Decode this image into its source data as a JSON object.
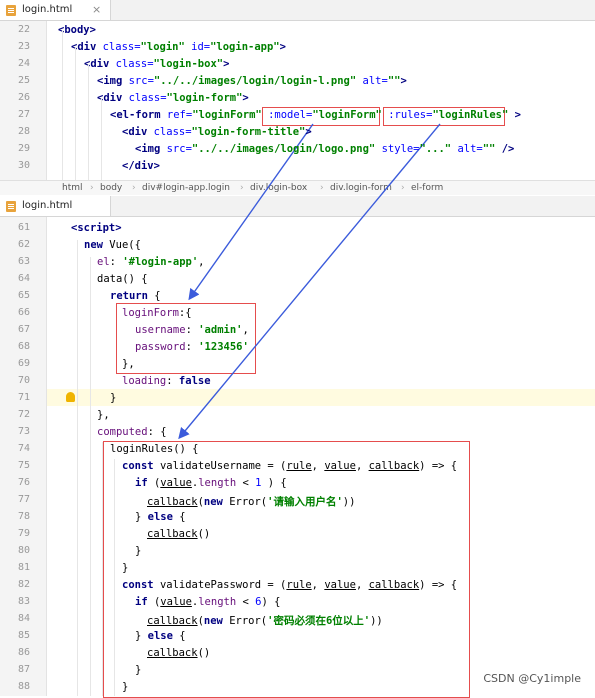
{
  "top_pane": {
    "tab": {
      "filename": "login.html",
      "close": "×"
    },
    "lines": [
      {
        "n": "22",
        "segs": [
          [
            "tag",
            "<body>"
          ]
        ]
      },
      {
        "n": "23",
        "segs": [
          [
            "tag",
            "<div "
          ],
          [
            "attr",
            "class="
          ],
          [
            "str",
            "\"login\" "
          ],
          [
            "attr",
            "id="
          ],
          [
            "str",
            "\"login-app\""
          ],
          [
            "tag",
            ">"
          ]
        ]
      },
      {
        "n": "24",
        "segs": [
          [
            "tag",
            "<div "
          ],
          [
            "attr",
            "class="
          ],
          [
            "str",
            "\"login-box\""
          ],
          [
            "tag",
            ">"
          ]
        ]
      },
      {
        "n": "25",
        "segs": [
          [
            "tag",
            "<img "
          ],
          [
            "attr",
            "src="
          ],
          [
            "str",
            "\"../../images/login/login-l.png\" "
          ],
          [
            "attr",
            "alt="
          ],
          [
            "str",
            "\"\""
          ],
          [
            "tag",
            ">"
          ]
        ]
      },
      {
        "n": "26",
        "segs": [
          [
            "tag",
            "<div "
          ],
          [
            "attr",
            "class="
          ],
          [
            "str",
            "\"login-form\""
          ],
          [
            "tag",
            ">"
          ]
        ]
      },
      {
        "n": "27",
        "segs": [
          [
            "tag",
            "<el-form "
          ],
          [
            "attr",
            "ref="
          ],
          [
            "str",
            "\"loginForm\" "
          ],
          [
            "attr",
            ":model="
          ],
          [
            "str",
            "\"loginForm\" "
          ],
          [
            "attr",
            ":rules="
          ],
          [
            "str",
            "\"loginRules\" "
          ],
          [
            "tag",
            ">"
          ]
        ]
      },
      {
        "n": "28",
        "segs": [
          [
            "tag",
            "<div "
          ],
          [
            "attr",
            "class="
          ],
          [
            "str",
            "\"login-form-title\""
          ],
          [
            "tag",
            ">"
          ]
        ]
      },
      {
        "n": "29",
        "segs": [
          [
            "tag",
            "<img "
          ],
          [
            "attr",
            "src="
          ],
          [
            "str",
            "\"../../images/login/logo.png\" "
          ],
          [
            "attr",
            "style="
          ],
          [
            "str",
            "\"...\" "
          ],
          [
            "attr",
            "alt="
          ],
          [
            "str",
            "\"\" "
          ],
          [
            "tag",
            "/>"
          ]
        ]
      },
      {
        "n": "30",
        "segs": [
          [
            "tag",
            "</div>"
          ]
        ]
      }
    ],
    "breadcrumb": [
      "html",
      "body",
      "div#login-app.login",
      "div.login-box",
      "div.login-form",
      "el-form"
    ]
  },
  "bottom_pane": {
    "tab": {
      "filename": "login.html"
    },
    "lines": [
      {
        "n": "61",
        "segs": [
          [
            "tag",
            "<script>"
          ]
        ]
      },
      {
        "n": "62",
        "segs": [
          [
            "kw",
            "new "
          ],
          [
            "plain",
            "Vue({"
          ]
        ]
      },
      {
        "n": "63",
        "segs": [
          [
            "prop",
            "el"
          ],
          [
            "plain",
            ": "
          ],
          [
            "str",
            "'#login-app'"
          ],
          [
            "plain",
            ","
          ]
        ]
      },
      {
        "n": "64",
        "segs": [
          [
            "plain",
            "data() {"
          ]
        ]
      },
      {
        "n": "65",
        "segs": [
          [
            "kw",
            "return "
          ],
          [
            "plain",
            "{"
          ]
        ]
      },
      {
        "n": "66",
        "segs": [
          [
            "prop",
            "loginForm"
          ],
          [
            "plain",
            ":{"
          ]
        ]
      },
      {
        "n": "67",
        "segs": [
          [
            "prop",
            "username"
          ],
          [
            "plain",
            ": "
          ],
          [
            "str",
            "'admin'"
          ],
          [
            "plain",
            ","
          ]
        ]
      },
      {
        "n": "68",
        "segs": [
          [
            "prop",
            "password"
          ],
          [
            "plain",
            ": "
          ],
          [
            "str",
            "'123456'"
          ]
        ]
      },
      {
        "n": "69",
        "segs": [
          [
            "plain",
            "},"
          ]
        ]
      },
      {
        "n": "70",
        "segs": [
          [
            "prop",
            "loading"
          ],
          [
            "plain",
            ": "
          ],
          [
            "kw",
            "false"
          ]
        ]
      },
      {
        "n": "71",
        "segs": [
          [
            "plain",
            "}"
          ]
        ]
      },
      {
        "n": "72",
        "segs": [
          [
            "plain",
            "},"
          ]
        ]
      },
      {
        "n": "73",
        "segs": [
          [
            "prop",
            "computed"
          ],
          [
            "plain",
            ": {"
          ]
        ]
      },
      {
        "n": "74",
        "segs": [
          [
            "plain",
            "loginRules() {"
          ]
        ]
      },
      {
        "n": "75",
        "segs": [
          [
            "kw",
            "const "
          ],
          [
            "plain",
            "validateUsername = ("
          ],
          [
            "u",
            "rule"
          ],
          [
            "plain",
            ", "
          ],
          [
            "u",
            "value"
          ],
          [
            "plain",
            ", "
          ],
          [
            "u",
            "callback"
          ],
          [
            "plain",
            ") => {"
          ]
        ]
      },
      {
        "n": "76",
        "segs": [
          [
            "kw",
            "if "
          ],
          [
            "plain",
            "("
          ],
          [
            "u",
            "value"
          ],
          [
            "plain",
            "."
          ],
          [
            "prop",
            "length"
          ],
          [
            "plain",
            " < "
          ],
          [
            "attr",
            "1"
          ],
          [
            "plain",
            " ) {"
          ]
        ]
      },
      {
        "n": "77",
        "segs": [
          [
            "u",
            "callback"
          ],
          [
            "plain",
            "("
          ],
          [
            "kw",
            "new "
          ],
          [
            "plain",
            "Error("
          ],
          [
            "str",
            "'请输入用户名'"
          ],
          [
            "plain",
            "))"
          ]
        ]
      },
      {
        "n": "78",
        "segs": [
          [
            "plain",
            "} "
          ],
          [
            "kw",
            "else "
          ],
          [
            "plain",
            "{"
          ]
        ]
      },
      {
        "n": "79",
        "segs": [
          [
            "u",
            "callback"
          ],
          [
            "plain",
            "()"
          ]
        ]
      },
      {
        "n": "80",
        "segs": [
          [
            "plain",
            "}"
          ]
        ]
      },
      {
        "n": "81",
        "segs": [
          [
            "plain",
            "}"
          ]
        ]
      },
      {
        "n": "82",
        "segs": [
          [
            "kw",
            "const "
          ],
          [
            "plain",
            "validatePassword = ("
          ],
          [
            "u",
            "rule"
          ],
          [
            "plain",
            ", "
          ],
          [
            "u",
            "value"
          ],
          [
            "plain",
            ", "
          ],
          [
            "u",
            "callback"
          ],
          [
            "plain",
            ") => {"
          ]
        ]
      },
      {
        "n": "83",
        "segs": [
          [
            "kw",
            "if "
          ],
          [
            "plain",
            "("
          ],
          [
            "u",
            "value"
          ],
          [
            "plain",
            "."
          ],
          [
            "prop",
            "length"
          ],
          [
            "plain",
            " < "
          ],
          [
            "attr",
            "6"
          ],
          [
            "plain",
            ") {"
          ]
        ]
      },
      {
        "n": "84",
        "segs": [
          [
            "u",
            "callback"
          ],
          [
            "plain",
            "("
          ],
          [
            "kw",
            "new "
          ],
          [
            "plain",
            "Error("
          ],
          [
            "str",
            "'密码必须在6位以上'"
          ],
          [
            "plain",
            "))"
          ]
        ]
      },
      {
        "n": "85",
        "segs": [
          [
            "plain",
            "} "
          ],
          [
            "kw",
            "else "
          ],
          [
            "plain",
            "{"
          ]
        ]
      },
      {
        "n": "86",
        "segs": [
          [
            "u",
            "callback"
          ],
          [
            "plain",
            "()"
          ]
        ]
      },
      {
        "n": "87",
        "segs": [
          [
            "plain",
            "}"
          ]
        ]
      },
      {
        "n": "88",
        "segs": [
          [
            "plain",
            "}"
          ]
        ]
      }
    ]
  },
  "watermark": "CSDN @Cy1imple",
  "colors": {
    "annotation_box": "#e54d4d",
    "arrow": "#3b5bdb",
    "current_line": "#fffbe0"
  },
  "icons": [
    "html-file-icon",
    "close-icon",
    "lightbulb-icon"
  ]
}
